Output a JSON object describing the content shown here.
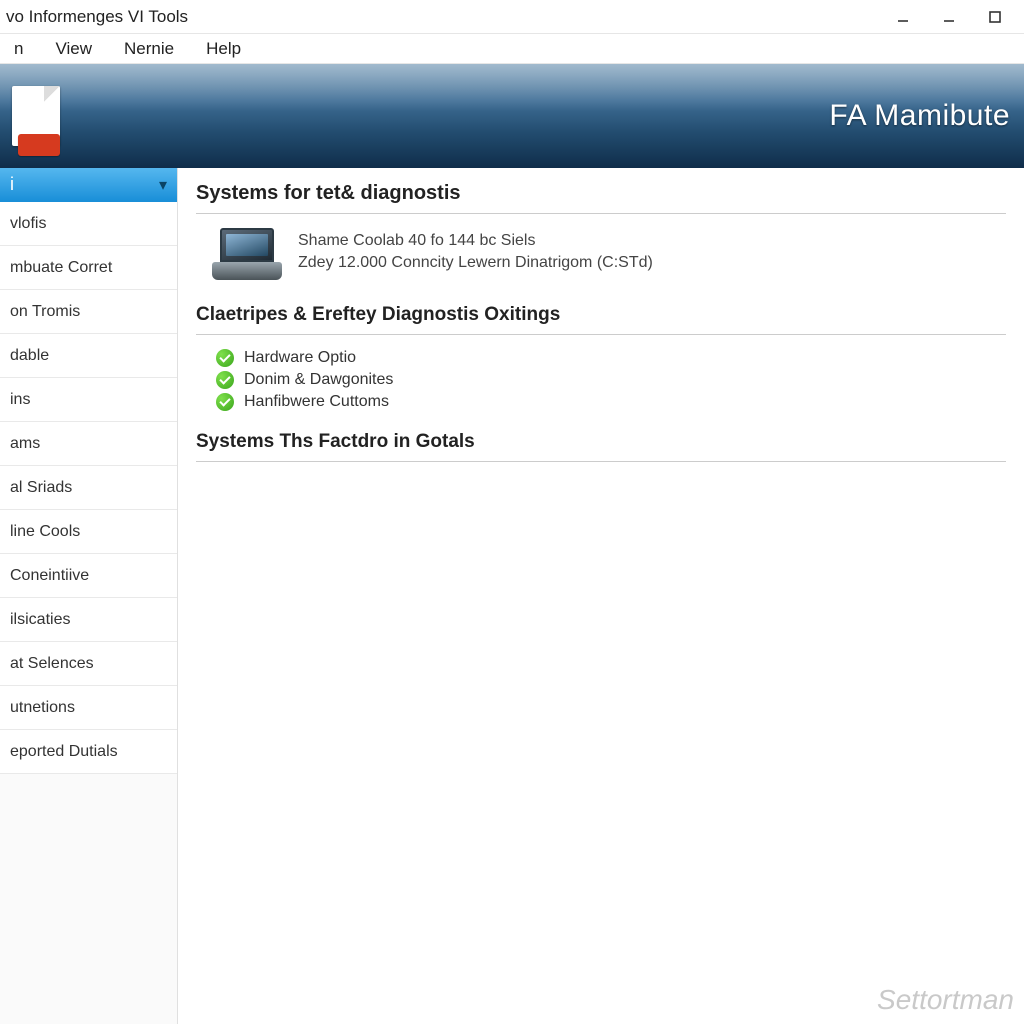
{
  "window": {
    "title": "vo Informenges VI Tools"
  },
  "menubar": [
    "n",
    "View",
    "Nernie",
    "Help"
  ],
  "banner": {
    "brand": "FA Mamibute"
  },
  "sidebar": {
    "header": "i",
    "items": [
      "vlofis",
      "mbuate Corret",
      "on Tromis",
      "dable",
      "ins",
      "ams",
      "al Sriads",
      "line Cools",
      "Coneintiive",
      "ilsicaties",
      "at Selences",
      "utnetions",
      "eported Dutials"
    ]
  },
  "content": {
    "heading1": "Systems for tet& diagnostis",
    "system": {
      "line1": "Shame Coolab 40 fo 144 bc Siels",
      "line2": "Zdey 12.000 Conncity Lewern Dinatrigom (C:STd)"
    },
    "heading2": "Claetripes & Ereftey Diagnostis Oxitings",
    "checks": [
      "Hardware Optio",
      "Donim & Dawgonites",
      "Hanfibwere Cuttoms"
    ],
    "heading3": "Systems Ths Factdro in Gotals"
  },
  "watermark": "Settortman"
}
